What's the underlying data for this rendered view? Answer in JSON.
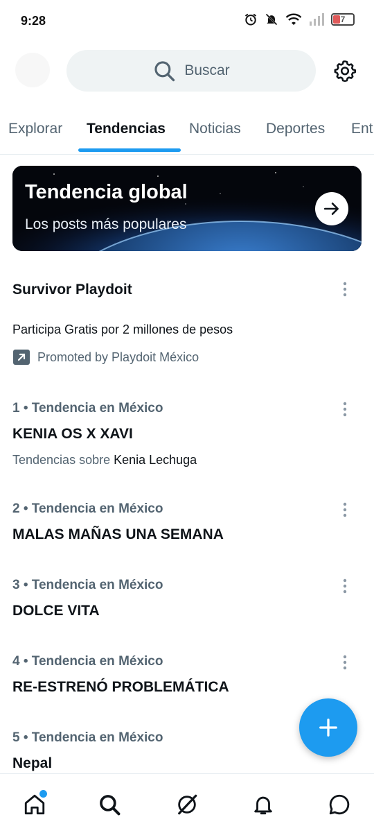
{
  "status_bar": {
    "time": "9:28",
    "battery": "7"
  },
  "search": {
    "placeholder": "Buscar"
  },
  "tabs": [
    {
      "label": "Explorar"
    },
    {
      "label": "Tendencias"
    },
    {
      "label": "Noticias"
    },
    {
      "label": "Deportes"
    },
    {
      "label": "Ent"
    }
  ],
  "banner": {
    "title": "Tendencia global",
    "subtitle": "Los posts más populares"
  },
  "promoted": {
    "title": "Survivor Playdoit",
    "text": "Participa Gratis por 2 millones de pesos",
    "label": "Promoted by Playdoit México"
  },
  "trends": [
    {
      "meta": "1 • Tendencia en México",
      "title": "KENIA OS X XAVI",
      "sub_prefix": "Tendencias sobre ",
      "sub_who": "Kenia Lechuga"
    },
    {
      "meta": "2 • Tendencia en México",
      "title": "MALAS MAÑAS UNA SEMANA"
    },
    {
      "meta": "3 • Tendencia en México",
      "title": "DOLCE VITA"
    },
    {
      "meta": "4 • Tendencia en México",
      "title": "RE-ESTRENÓ PROBLEMÁTICA"
    },
    {
      "meta": "5 • Tendencia en México",
      "title": "Nepal"
    }
  ],
  "colors": {
    "accent": "#1d9bf0",
    "secondary_text": "#536471"
  },
  "icons": {
    "header": [
      "search-icon",
      "gear-icon"
    ],
    "nav": [
      "home-icon",
      "search-icon",
      "grok-icon",
      "bell-icon",
      "messages-icon"
    ]
  }
}
